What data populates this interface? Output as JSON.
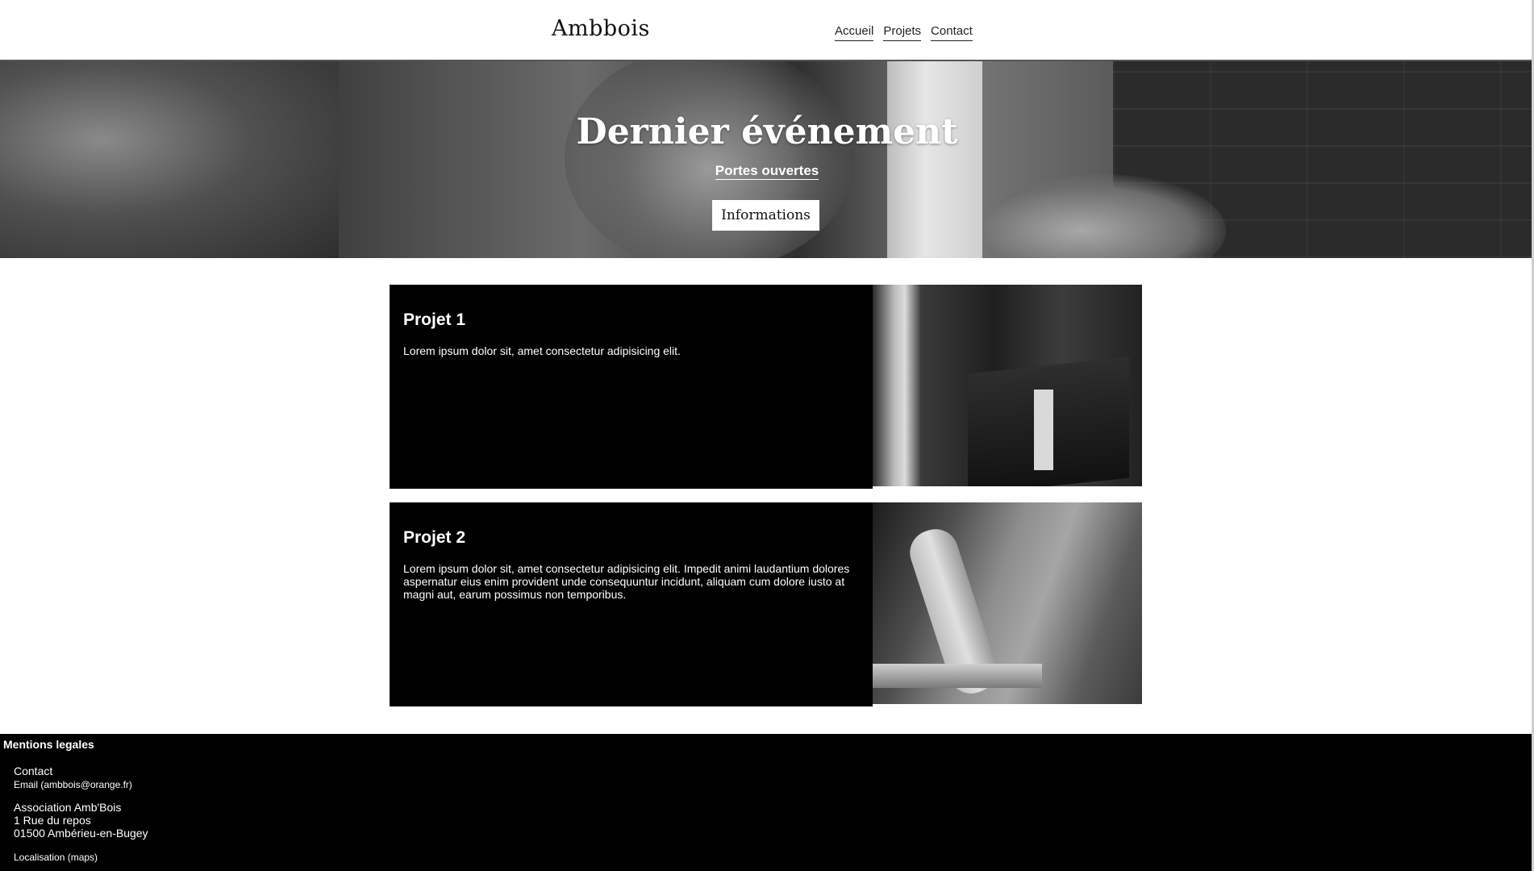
{
  "header": {
    "logo": "Ambbois",
    "nav": [
      "Accueil",
      "Projets",
      "Contact"
    ]
  },
  "hero": {
    "title": "Dernier événement",
    "subtitle": "Portes ouvertes",
    "button": "Informations"
  },
  "projects": [
    {
      "title": "Projet 1",
      "text": "Lorem ipsum dolor sit, amet consectetur adipisicing elit."
    },
    {
      "title": "Projet 2",
      "text": "Lorem ipsum dolor sit, amet consectetur adipisicing elit. Impedit animi laudantium dolores aspernatur eius enim provident unde consequuntur incidunt, aliquam cum dolore iusto at magni aut, earum possimus non temporibus."
    }
  ],
  "footer": {
    "mentions": "Mentions legales",
    "contact_title": "Contact",
    "email": "Email (ambbois@orange.fr)",
    "address": [
      "Association Amb'Bois",
      "1 Rue du repos",
      "01500 Ambérieu-en-Bugey"
    ],
    "maps": "Localisation (maps)"
  }
}
